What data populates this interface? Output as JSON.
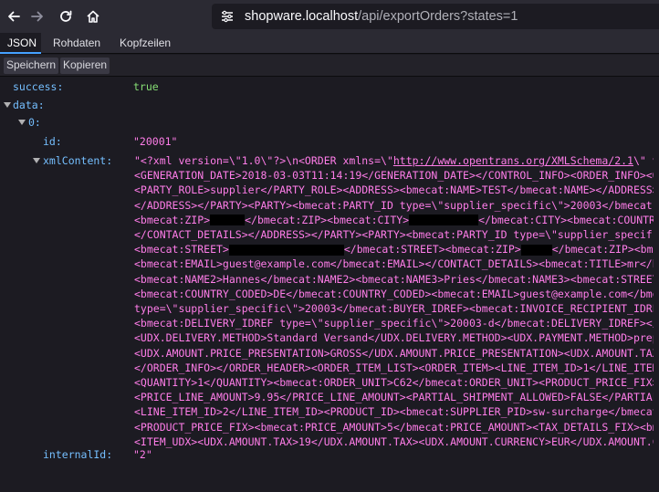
{
  "browser": {
    "url_host": "shopware.localhost",
    "url_path": "/api/exportOrders?states=1"
  },
  "viewer": {
    "tabs": [
      {
        "label": "JSON",
        "selected": true
      },
      {
        "label": "Rohdaten",
        "selected": false
      },
      {
        "label": "Kopfzeilen",
        "selected": false
      }
    ],
    "toolbar": {
      "save_label": "Speichern",
      "copy_label": "Kopieren"
    }
  },
  "json": {
    "success_key": "success:",
    "success_value": "true",
    "data_key": "data:",
    "index_key": "0:",
    "id_key": "id:",
    "id_value": "\"20001\"",
    "xml_key": "xmlContent:",
    "internal_key": "internalId:",
    "internal_value": "\"2\"",
    "xml_lines": [
      {
        "pre": "\"<?xml version=\\\"1.0\\\"?>\\n<ORDER xmlns=\\\"",
        "link": "http://www.opentrans.org/XMLSchema/2.1",
        "post": "\\\" v"
      },
      {
        "text": "<GENERATION_DATE>2018-03-03T11:14:19</GENERATION_DATE></CONTROL_INFO><ORDER_INFO><O"
      },
      {
        "text": "<PARTY_ROLE>supplier</PARTY_ROLE><ADDRESS><bmecat:NAME>TEST</bmecat:NAME></ADDRESS>"
      },
      {
        "text": "</ADDRESS></PARTY><PARTY><bmecat:PARTY_ID type=\\\"supplier_specific\\\">20003</bmecat"
      },
      {
        "a": "<bmecat:ZIP>",
        "r1": 38,
        "b": "</bmecat:ZIP><bmecat:CITY>",
        "r2": 76,
        "c": "</bmecat:CITY><bmecat:COUNTRY"
      },
      {
        "text": "</CONTACT_DETAILS></ADDRESS></PARTY><PARTY><bmecat:PARTY_ID type=\\\"supplier_specif"
      },
      {
        "a": "<bmecat:STREET>",
        "r1": 126,
        "b": "</bmecat:STREET><bmecat:ZIP>",
        "r2": 34,
        "c": "</bmecat:ZIP><bme"
      },
      {
        "text": "<bmecat:EMAIL>guest@example.com</bmecat:EMAIL></CONTACT_DETAILS><bmecat:TITLE>mr</bm"
      },
      {
        "text": "<bmecat:NAME2>Hannes</bmecat:NAME2><bmecat:NAME3>Pries</bmecat:NAME3><bmecat:STREET"
      },
      {
        "text": "<bmecat:COUNTRY_CODED>DE</bmecat:COUNTRY_CODED><bmecat:EMAIL>guest@example.com</bmec"
      },
      {
        "text": "type=\\\"supplier_specific\\\">20003</bmecat:BUYER_IDREF><bmecat:INVOICE_RECIPIENT_IDRE"
      },
      {
        "text": "<bmecat:DELIVERY_IDREF type=\\\"supplier_specific\\\">20003-d</bmecat:DELIVERY_IDREF></"
      },
      {
        "text": "<UDX.DELIVERY.METHOD>Standard Versand</UDX.DELIVERY.METHOD><UDX.PAYMENT.METHOD>prep"
      },
      {
        "text": "<UDX.AMOUNT.PRICE_PRESENTATION>GROSS</UDX.AMOUNT.PRICE_PRESENTATION><UDX.AMOUNT.TAX"
      },
      {
        "text": "</ORDER_INFO></ORDER_HEADER><ORDER_ITEM_LIST><ORDER_ITEM><LINE_ITEM_ID>1</LINE_ITEM"
      },
      {
        "text": "<QUANTITY>1</QUANTITY><bmecat:ORDER_UNIT>C62</bmecat:ORDER_UNIT><PRODUCT_PRICE_FIX>"
      },
      {
        "text": "<PRICE_LINE_AMOUNT>9.95</PRICE_LINE_AMOUNT><PARTIAL_SHIPMENT_ALLOWED>FALSE</PARTIAL"
      },
      {
        "text": "<LINE_ITEM_ID>2</LINE_ITEM_ID><PRODUCT_ID><bmecat:SUPPLIER_PID>sw-surcharge</bmecat"
      },
      {
        "text": "<PRODUCT_PRICE_FIX><bmecat:PRICE_AMOUNT>5</bmecat:PRICE_AMOUNT><TAX_DETAILS_FIX><bm"
      },
      {
        "text": "<ITEM_UDX><UDX.AMOUNT.TAX>19</UDX.AMOUNT.TAX><UDX.AMOUNT.CURRENCY>EUR</UDX.AMOUNT.C"
      }
    ]
  }
}
